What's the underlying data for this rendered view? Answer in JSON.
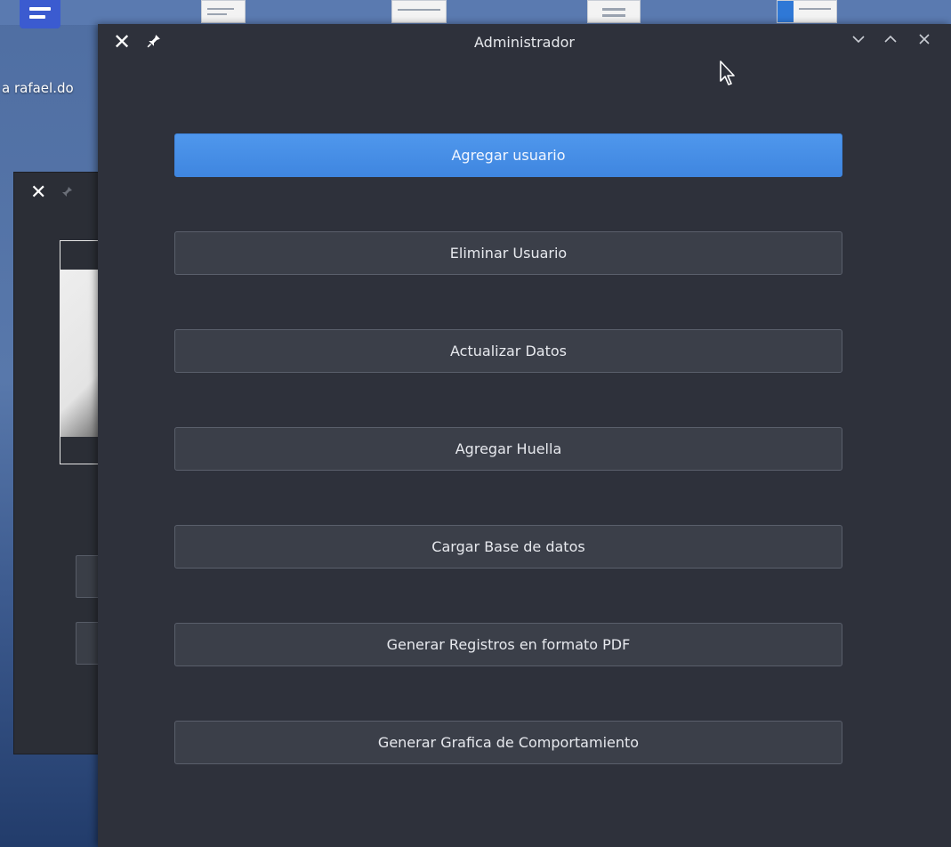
{
  "desktop": {
    "label": "a rafael.do"
  },
  "back_window": {
    "close_icon": "close-icon",
    "pin_icon": "pin-icon"
  },
  "window": {
    "title": "Administrador",
    "icons": {
      "close": "✕",
      "pin": "pin-icon",
      "minimize": "chevron-down-icon",
      "maximize": "chevron-up-icon",
      "close_right": "close-icon"
    }
  },
  "actions": [
    {
      "label": "Agregar usuario",
      "primary": true
    },
    {
      "label": "Eliminar Usuario"
    },
    {
      "label": "Actualizar Datos"
    },
    {
      "label": "Agregar Huella"
    },
    {
      "label": "Cargar Base de datos"
    },
    {
      "label": "Generar Registros en formato PDF"
    },
    {
      "label": "Generar Grafica de Comportamiento"
    }
  ],
  "colors": {
    "window_bg": "#2e313b",
    "button_bg": "#3b3f49",
    "button_border": "#5a5f6b",
    "accent": "#4a90e2",
    "text": "#e7e9ee"
  }
}
